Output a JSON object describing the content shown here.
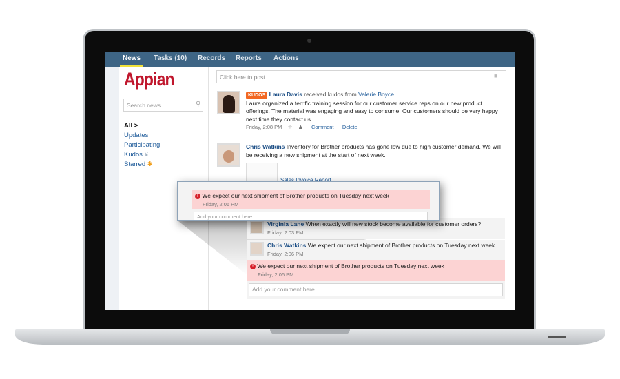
{
  "nav": {
    "tabs": [
      "News",
      "Tasks (10)",
      "Records",
      "Reports",
      "Actions"
    ],
    "active": "News"
  },
  "sidebar": {
    "logo": "Appian",
    "search_placeholder": "Search news",
    "filters": [
      "All >",
      "Updates",
      "Participating",
      "Kudos",
      "Starred"
    ]
  },
  "composer": {
    "placeholder": "Click here to post..."
  },
  "posts": [
    {
      "badge": "KUDOS",
      "author": "Laura Davis",
      "action": "received kudos from",
      "target": "Valerie Boyce",
      "text": "Laura organized a terrific training session for our customer service reps on our new product offerings. The material was engaging and easy to consume. Our customers should be very happy next time they contact us.",
      "time": "Friday, 2:08 PM",
      "comment": "Comment",
      "delete": "Delete"
    },
    {
      "author": "Chris Watkins",
      "text": "Inventory for Brother products has gone low due to high customer demand.  We will be receiving a new shipment at the start of next week.",
      "attachment": "Sales Invoice Report"
    }
  ],
  "comments": [
    {
      "author": "Virginia Lane",
      "text": "When exactly will new stock become available for customer orders?",
      "time": "Friday, 2:03 PM"
    },
    {
      "author": "Chris Watkins",
      "text": "We expect our next shipment of Brother products on Tuesday next week",
      "time": "Friday, 2:06 PM"
    }
  ],
  "error": {
    "text": "We expect our next shipment of Brother products on Tuesday next week",
    "time": "Friday, 2:06 PM"
  },
  "comment_placeholder": "Add your comment here...",
  "colors": {
    "nav": "#3e6585",
    "brand": "#c0172d",
    "kudos": "#f26722",
    "error_bg": "#fcd3d3",
    "link": "#1d4f86"
  }
}
